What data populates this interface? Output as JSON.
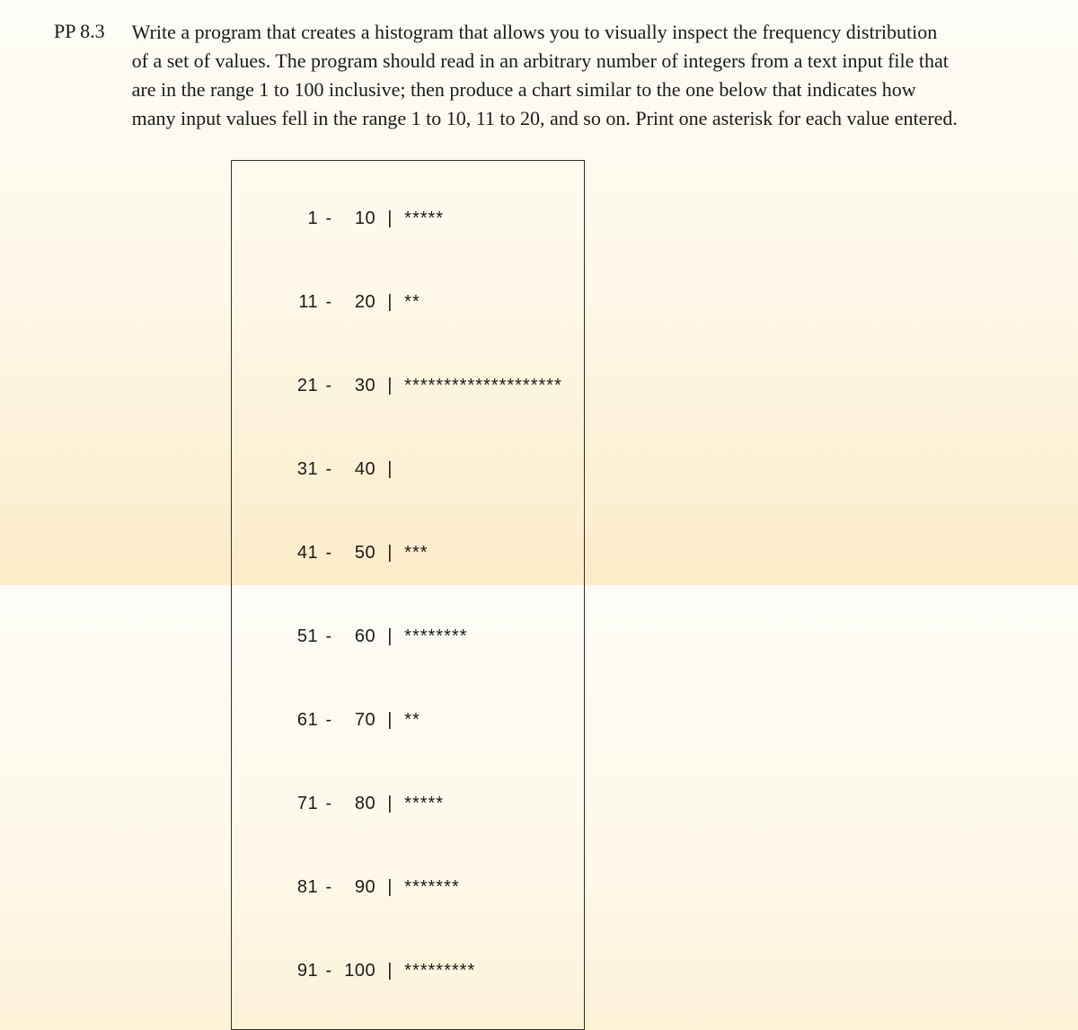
{
  "exercise": {
    "label": "PP 8.3",
    "description": "Write a program that creates a histogram that allows you to visually inspect the frequency distribution of a set of values. The program should read in an arbitrary number of integers from a text input file that are in the range 1 to 100 inclusive; then produce a chart similar to the one below that indicates how many input values fell in the range 1 to 10, 11 to 20, and so on. Print one asterisk for each value entered."
  },
  "chart_data": {
    "type": "bar",
    "title": "",
    "xlabel": "",
    "ylabel": "",
    "categories": [
      "1 - 10",
      "11 - 20",
      "21 - 30",
      "31 - 40",
      "41 - 50",
      "51 - 60",
      "61 - 70",
      "71 - 80",
      "81 - 90",
      "91 - 100"
    ],
    "values": [
      5,
      2,
      20,
      0,
      3,
      8,
      2,
      5,
      7,
      9
    ],
    "rows": [
      {
        "start": "1",
        "end": "10",
        "stars": "*****"
      },
      {
        "start": "11",
        "end": "20",
        "stars": "**"
      },
      {
        "start": "21",
        "end": "30",
        "stars": "********************"
      },
      {
        "start": "31",
        "end": "40",
        "stars": ""
      },
      {
        "start": "41",
        "end": "50",
        "stars": "***"
      },
      {
        "start": "51",
        "end": "60",
        "stars": "********"
      },
      {
        "start": "61",
        "end": "70",
        "stars": "**"
      },
      {
        "start": "71",
        "end": "80",
        "stars": "*****"
      },
      {
        "start": "81",
        "end": "90",
        "stars": "*******"
      },
      {
        "start": "91",
        "end": "100",
        "stars": "*********"
      }
    ]
  },
  "symbols": {
    "dash": "-",
    "pipe": "|"
  }
}
